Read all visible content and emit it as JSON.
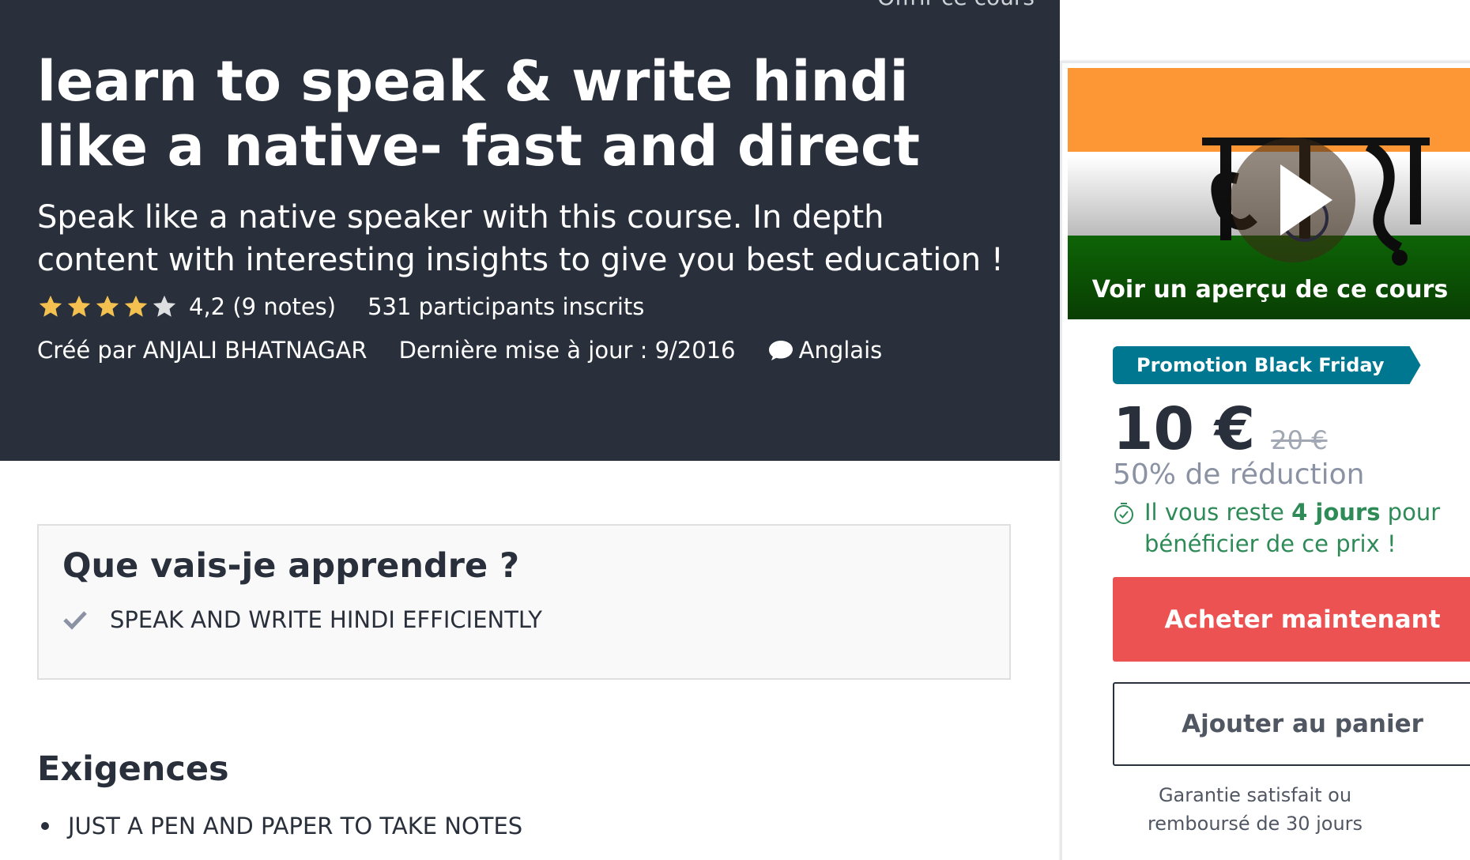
{
  "header": {
    "gift_label": "Offrir ce cours"
  },
  "course": {
    "title": "learn to speak & write hindi like a native- fast and direct",
    "subtitle": "Speak like a native speaker with this course. In depth content with interesting insights to give you best education !",
    "rating": {
      "value": 4.2,
      "stars_filled": 4,
      "stars_total": 5,
      "text": "4,2 (9 notes)"
    },
    "enrolled": "531 participants inscrits",
    "author": "Créé par ANJALI BHATNAGAR",
    "updated": "Dernière mise à jour : 9/2016",
    "language": "Anglais"
  },
  "sidebar": {
    "preview_label": "Voir un aperçu de ce cours",
    "promo_badge": "Promotion Black Friday",
    "price": "10 €",
    "old_price": "20 €",
    "discount": "50% de réduction",
    "timer_prefix": "Il vous reste ",
    "timer_days": "4 jours",
    "timer_suffix": " pour bénéficier de ce prix !",
    "buy_label": "Acheter maintenant",
    "cart_label": "Ajouter au panier",
    "guarantee": "Garantie satisfait ou remboursé de 30 jours"
  },
  "learn": {
    "title": "Que vais-je apprendre ?",
    "items": [
      "SPEAK AND WRITE HINDI EFFICIENTLY"
    ]
  },
  "requirements": {
    "title": "Exigences",
    "items": [
      "JUST A PEN AND PAPER TO TAKE NOTES"
    ]
  },
  "colors": {
    "hero_bg": "#29303b",
    "star": "#f4c150",
    "star_empty": "#dedfe0",
    "promo": "#007791",
    "buy": "#ec5252",
    "timer_green": "#2e8b57"
  },
  "icons": [
    "star-icon",
    "speech-bubble-icon",
    "play-icon",
    "timer-icon",
    "check-icon",
    "bullet-icon"
  ]
}
